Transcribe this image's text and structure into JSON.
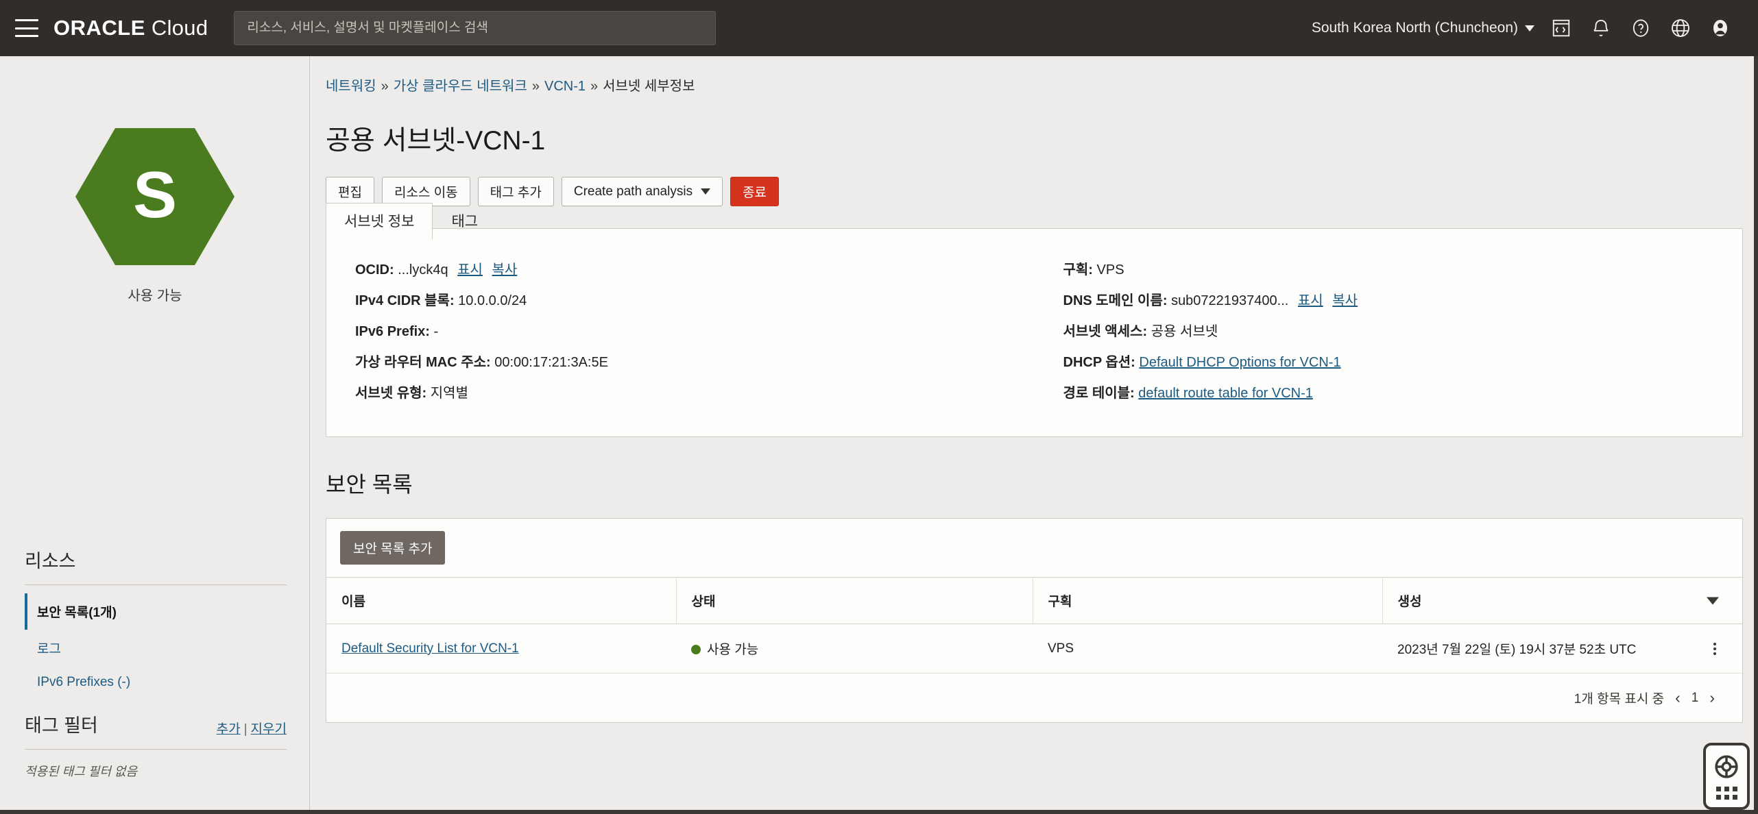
{
  "topbar": {
    "menu_icon": "hamburger-icon",
    "brand_oracle": "ORACLE",
    "brand_cloud": "Cloud",
    "search_placeholder": "리소스, 서비스, 설명서 및 마켓플레이스 검색",
    "search_value": "",
    "region": "South Korea North (Chuncheon)",
    "icons": [
      "cloud-shell-icon",
      "notifications-bell-icon",
      "help-question-icon",
      "language-globe-icon",
      "user-profile-icon"
    ],
    "colors": {
      "background": "#312d2a",
      "search_bg": "#4a4541"
    }
  },
  "breadcrumb": {
    "items": [
      "네트워킹",
      "가상 클라우드 네트워크",
      "VCN-1"
    ],
    "current": "서브넷 세부정보",
    "separator": "»"
  },
  "page": {
    "title": "공용 서브넷-VCN-1"
  },
  "actions": {
    "edit": "편집",
    "move_resource": "리소스 이동",
    "add_tags": "태그 추가",
    "create_path_analysis": "Create path analysis",
    "terminate": "종료"
  },
  "sidebar": {
    "hex_letter": "S",
    "hex_color": "#4a7c1f",
    "status": "사용 가능",
    "resources_title": "리소스",
    "resources": [
      {
        "label": "보안 목록(1개)",
        "active": true
      },
      {
        "label": "로그",
        "active": false
      },
      {
        "label": "IPv6 Prefixes (-)",
        "active": false
      }
    ],
    "tag_filter_title": "태그 필터",
    "tag_filter_add": "추가",
    "tag_filter_separator": "|",
    "tag_filter_clear": "지우기",
    "tag_filter_note": "적용된 태그 필터 없음"
  },
  "tabs": [
    {
      "label": "서브넷 정보",
      "active": true
    },
    {
      "label": "태그",
      "active": false
    }
  ],
  "info": {
    "left": [
      {
        "label": "OCID:",
        "value": "...lyck4q",
        "links": [
          "표시",
          "복사"
        ]
      },
      {
        "label": "IPv4 CIDR 블록:",
        "value": "10.0.0.0/24",
        "links": []
      },
      {
        "label": "IPv6 Prefix:",
        "value": "-",
        "links": []
      },
      {
        "label": "가상 라우터 MAC 주소:",
        "value": "00:00:17:21:3A:5E",
        "links": []
      },
      {
        "label": "서브넷 유형:",
        "value": "지역별",
        "links": []
      }
    ],
    "right": [
      {
        "label": "구획:",
        "value": "VPS",
        "links": [],
        "ref": ""
      },
      {
        "label": "DNS 도메인 이름:",
        "value": "sub07221937400...",
        "links": [
          "표시",
          "복사"
        ],
        "ref": ""
      },
      {
        "label": "서브넷 액세스:",
        "value": "공용 서브넷",
        "links": [],
        "ref": ""
      },
      {
        "label": "DHCP 옵션:",
        "value": "",
        "links": [],
        "ref": "Default DHCP Options for VCN-1"
      },
      {
        "label": "경로 테이블:",
        "value": "",
        "links": [],
        "ref": "default route table for VCN-1"
      }
    ]
  },
  "security_lists": {
    "title": "보안 목록",
    "add_button": "보안 목록 추가",
    "columns": [
      "이름",
      "상태",
      "구획",
      "생성"
    ],
    "rows": [
      {
        "name": "Default Security List for VCN-1",
        "state": "사용 가능",
        "state_color": "#4a7c1f",
        "compartment": "VPS",
        "created": "2023년 7월 22일 (토) 19시 37분 52초 UTC"
      }
    ],
    "pager": {
      "showing": "1개 항목 표시 중",
      "prev": "‹",
      "page": "1",
      "next": "›"
    }
  },
  "help_widget": {
    "icon": "lifebuoy-icon",
    "grid_icon": "app-grid-icon"
  }
}
